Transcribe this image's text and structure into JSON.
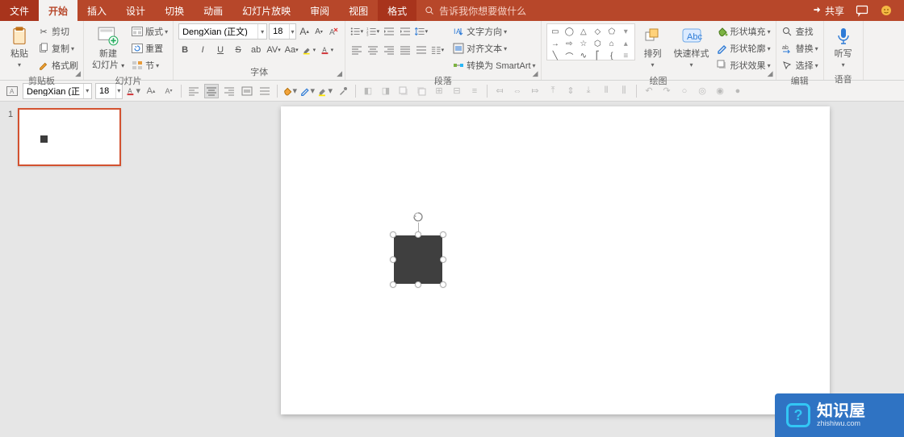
{
  "tabs": {
    "file": "文件",
    "home": "开始",
    "insert": "插入",
    "design": "设计",
    "transitions": "切换",
    "animations": "动画",
    "slideshow": "幻灯片放映",
    "review": "审阅",
    "view": "视图",
    "format": "格式"
  },
  "tell_me_placeholder": "告诉我你想要做什么",
  "titlebar": {
    "share": "共享"
  },
  "ribbon": {
    "clipboard": {
      "paste": "粘贴",
      "cut": "剪切",
      "copy": "复制",
      "format_painter": "格式刷",
      "group_label": "剪贴板"
    },
    "slides": {
      "new_slide_l1": "新建",
      "new_slide_l2": "幻灯片",
      "layout": "版式",
      "reset": "重置",
      "section": "节",
      "group_label": "幻灯片"
    },
    "font": {
      "name_value": "DengXian (正文)",
      "size_value": "18",
      "group_label": "字体",
      "bold": "B",
      "italic": "I",
      "underline": "U",
      "strike": "S"
    },
    "paragraph": {
      "text_direction": "文字方向",
      "align_text": "对齐文本",
      "convert_smartart": "转换为 SmartArt",
      "group_label": "段落"
    },
    "drawing": {
      "arrange": "排列",
      "quick_styles": "快速样式",
      "shape_fill": "形状填充",
      "shape_outline": "形状轮廓",
      "shape_effects": "形状效果",
      "group_label": "绘图"
    },
    "editing": {
      "find": "查找",
      "replace": "替换",
      "select": "选择",
      "group_label": "编辑"
    },
    "voice": {
      "dictate": "听写",
      "group_label": "语音"
    }
  },
  "qat": {
    "font_name": "DengXian (正",
    "font_size": "18"
  },
  "thumbnail": {
    "number": "1"
  },
  "watermark": {
    "title": "知识屋",
    "url": "zhishiwu.com"
  }
}
